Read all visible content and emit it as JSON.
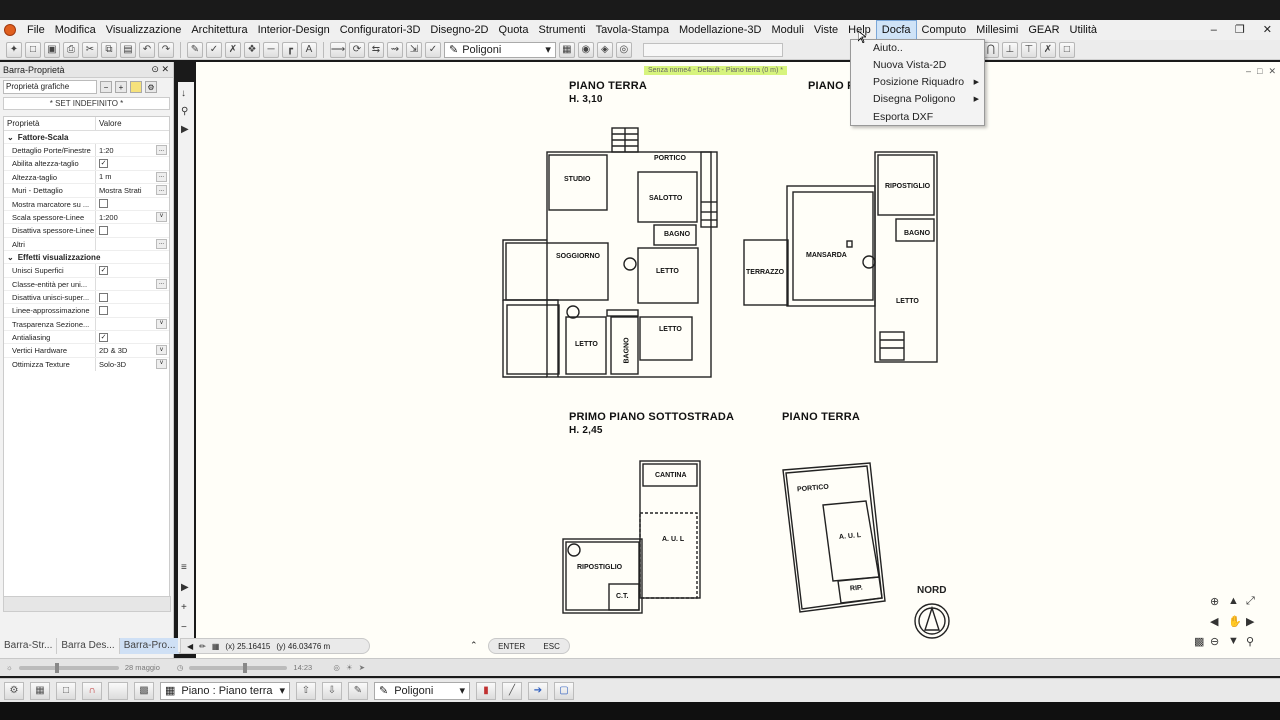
{
  "menubar": {
    "items": [
      "File",
      "Modifica",
      "Visualizzazione",
      "Architettura",
      "Interior-Design",
      "Configuratori-3D",
      "Disegno-2D",
      "Quota",
      "Strumenti",
      "Tavola-Stampa",
      "Modellazione-3D",
      "Moduli",
      "Viste",
      "Help",
      "Docfa",
      "Computo",
      "Millesimi",
      "GEAR",
      "Utilità"
    ],
    "active": "Docfa"
  },
  "toolbar": {
    "combo_value": "Poligoni"
  },
  "dropdown": {
    "items": [
      {
        "label": "Aiuto..",
        "submenu": false
      },
      {
        "label": "Nuova Vista-2D",
        "submenu": false
      },
      {
        "label": "Posizione Riquadro",
        "submenu": true
      },
      {
        "label": "Disegna Poligono",
        "submenu": true
      },
      {
        "label": "Esporta DXF",
        "submenu": false
      }
    ]
  },
  "left_panel": {
    "title": "Barra-Proprietà",
    "combo": "Proprietà grafiche",
    "set_label": "* SET INDEFINITO *",
    "col_property": "Proprietà",
    "col_value": "Valore",
    "groups": [
      {
        "name": "Fattore-Scala",
        "rows": [
          {
            "name": "Dettaglio Porte/Finestre",
            "value": "1:20",
            "ctl": "..."
          },
          {
            "name": "Abilita altezza-taglio",
            "value": "",
            "checked": true
          },
          {
            "name": "Altezza-taglio",
            "value": "1 m",
            "ctl": "..."
          },
          {
            "name": "Muri - Dettaglio",
            "value": "Mostra Strati",
            "ctl": "..."
          },
          {
            "name": "Mostra marcatore su ...",
            "value": "",
            "checked": false
          },
          {
            "name": "Scala spessore-Linee",
            "value": "1:200",
            "ctl": "v"
          },
          {
            "name": "Disattiva spessore-Linee",
            "value": "",
            "checked": false
          },
          {
            "name": "Altri",
            "value": "",
            "ctl": "..."
          }
        ]
      },
      {
        "name": "Effetti visualizzazione",
        "rows": [
          {
            "name": "Unisci Superfici",
            "value": "",
            "checked": true
          },
          {
            "name": "Classe-entità per uni...",
            "value": "",
            "ctl": "..."
          },
          {
            "name": "Disattiva unisci-super...",
            "value": "",
            "checked": false
          },
          {
            "name": "Linee-approssimazione",
            "value": "",
            "checked": false
          },
          {
            "name": "Trasparenza Sezione...",
            "value": "",
            "ctl": "v"
          },
          {
            "name": "Antialiasing",
            "value": "",
            "checked": true
          },
          {
            "name": "Vertici Hardware",
            "value": "2D & 3D",
            "ctl": "v"
          },
          {
            "name": "Ottimizza Texture",
            "value": "Solo-3D",
            "ctl": "v"
          }
        ]
      }
    ],
    "tabs": [
      "Barra-Str...",
      "Barra Des...",
      "Barra-Pro..."
    ],
    "active_tab": "Barra-Pro..."
  },
  "canvas": {
    "status_tag": "Senza nome4 - Default - Piano terra (0 m) *",
    "titles": {
      "piano_terra_1": "PIANO TERRA",
      "piano_terra_1_h": "H. 3,10",
      "piano_primo_partial": "PIANO P",
      "sottostrada": "PRIMO PIANO SOTTOSTRADA",
      "sottostrada_h": "H. 2,45",
      "piano_terra_2": "PIANO TERRA"
    },
    "rooms": {
      "portico1": "PORTICO",
      "studio": "STUDIO",
      "salotto": "SALOTTO",
      "bagno1": "BAGNO",
      "soggiorno": "SOGGIORNO",
      "letto1": "LETTO",
      "letto2": "LETTO",
      "letto3": "LETTO",
      "bagno2": "BAGNO",
      "ripostiglio1": "RIPOSTIGLIO",
      "bagno3": "BAGNO",
      "mansarda": "MANSARDA",
      "terrazzo": "TERRAZZO",
      "letto4": "LETTO",
      "cantina": "CANTINA",
      "aul1": "A. U. L",
      "ripostiglio2": "RIPOSTIGLIO",
      "ct": "C.T.",
      "portico2": "PORTICO",
      "aul2": "A. U. L",
      "rip": "RIP."
    },
    "nord": "NORD"
  },
  "coords": {
    "x": "(x) 25.16415",
    "y": "(y) 46.03476 m"
  },
  "commands": [
    "ENTER",
    "ESC"
  ],
  "statusbar": {
    "date": "28 maggio",
    "time": "14:23"
  },
  "bottombar": {
    "floor_combo": "Piano : Piano terra",
    "poly_combo": "Poligoni"
  }
}
